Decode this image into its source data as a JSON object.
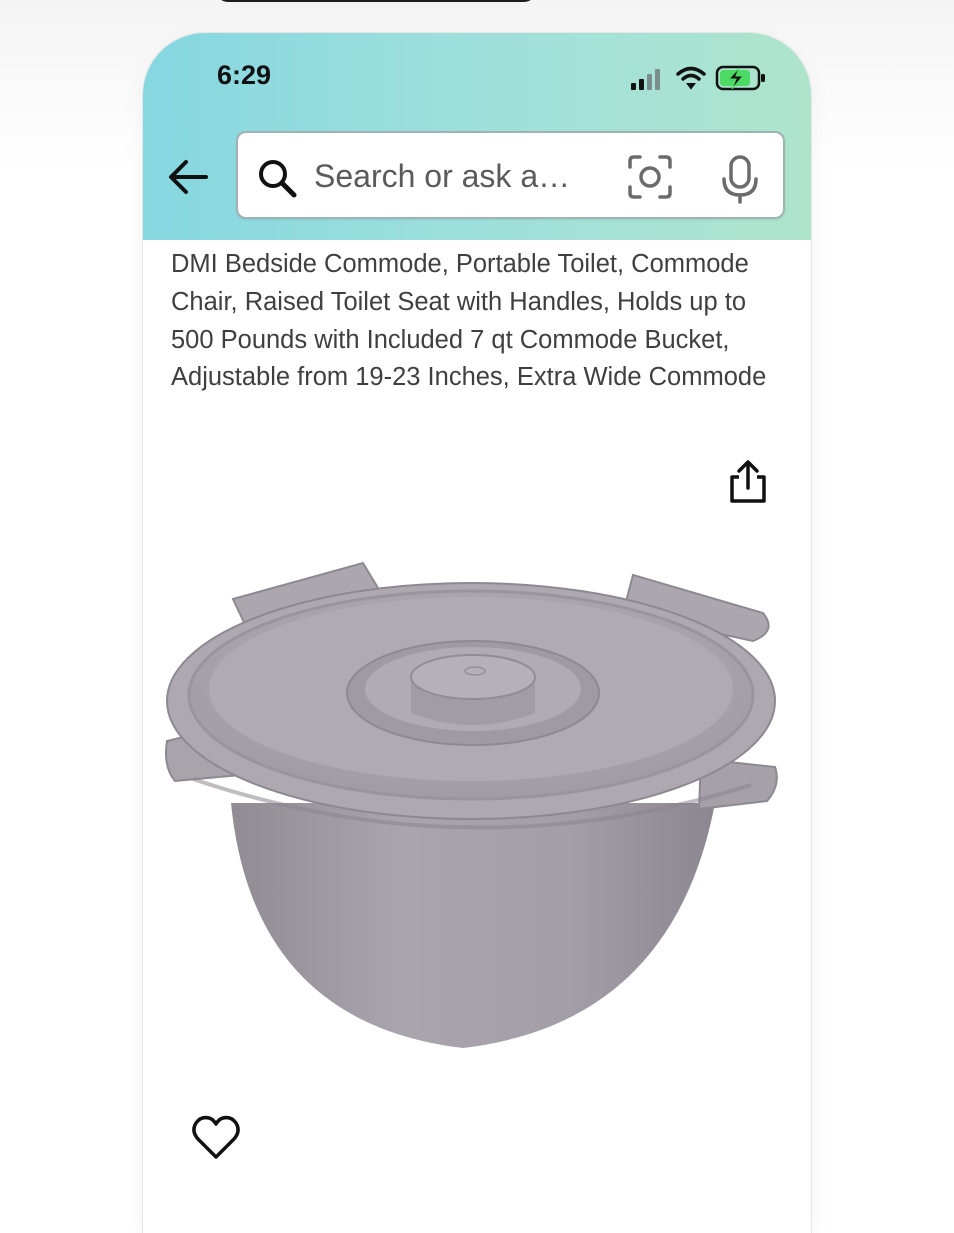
{
  "status_bar": {
    "time": "6:29",
    "icons": [
      "cellular-signal-icon",
      "wifi-icon",
      "battery-charging-icon"
    ]
  },
  "search": {
    "placeholder": "Search or ask a…",
    "icons": [
      "back-arrow-icon",
      "search-icon",
      "camera-lens-icon",
      "microphone-icon"
    ]
  },
  "product": {
    "title": "DMI Bedside Commode, Portable Toilet, Commode Chair, Raised Toilet Seat with Handles, Holds up to 500 Pounds with Included 7 qt Commode Bucket, Adjustable from 19-23 Inches, Extra Wide Commode",
    "actions": [
      "share-icon",
      "heart-icon"
    ]
  },
  "colors": {
    "header_left": "#85d7e0",
    "header_right": "#aee4cc",
    "text": "#3f3f3f",
    "bucket": "#a8a2aa"
  }
}
